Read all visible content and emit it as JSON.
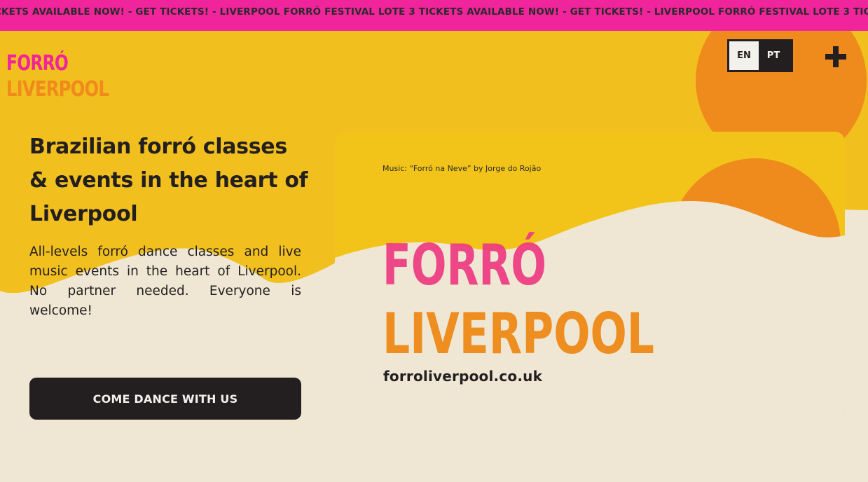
{
  "ticker": {
    "text": "CKETS AVAILABLE NOW! - GET TICKETS! - LIVERPOOL FORRÓ FESTIVAL LOTE 3 TICKETS AVAILABLE NOW! - GET TICKETS! - LIVERPOOL FORRÓ FESTIVAL LOTE 3 TICKETS"
  },
  "logo": {
    "line1": "FORRÓ",
    "line2": "LIVERPOOL"
  },
  "lang": {
    "en": "EN",
    "pt": "PT",
    "active": "EN"
  },
  "menu_icon": "plus-icon",
  "hero": {
    "headline": "Brazilian forró classes & events in the heart of Liverpool",
    "lede": "All-levels forró dance classes and live music events in the heart of Liverpool. No partner needed. Everyone is welcome!",
    "cta": "Come dance with us"
  },
  "video": {
    "music_credit": "Music: “Forró na Neve” by Jorge do Rojão",
    "logo_line1": "FORRÓ",
    "logo_line2": "LIVERPOOL",
    "url": "forroliverpool.co.uk"
  },
  "colors": {
    "pink": "#f0249b",
    "yellow": "#f2c01e",
    "orange": "#f08a1c",
    "cream": "#efe7d3",
    "dark": "#231f20"
  }
}
